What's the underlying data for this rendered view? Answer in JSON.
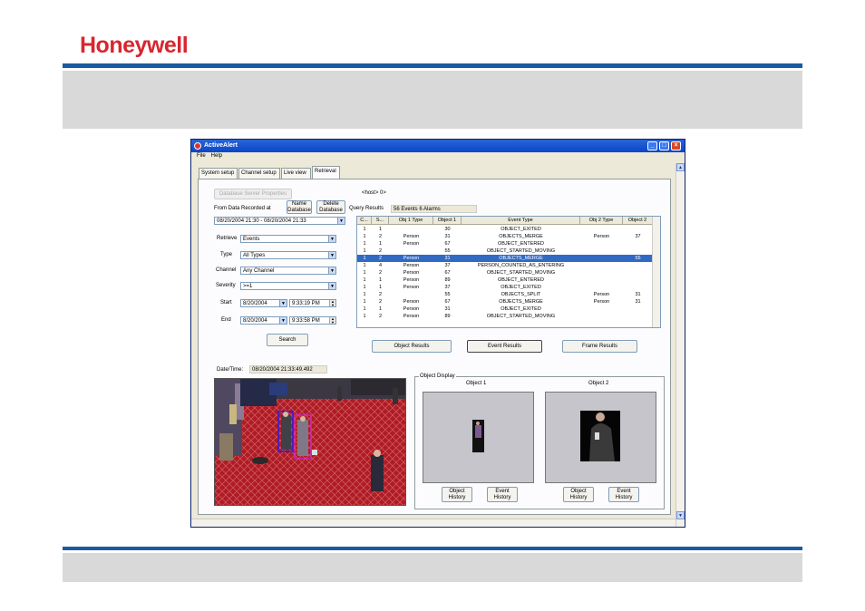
{
  "brand": {
    "logo": "Honeywell",
    "accent": "#d8262f",
    "line_color": "#1a5aa0"
  },
  "window": {
    "title": "ActiveAlert",
    "menu": [
      "File",
      "Help"
    ],
    "tabs": [
      "System setup",
      "Channel setup",
      "Live view",
      "Retrieval"
    ],
    "active_tab": "Retrieval"
  },
  "left": {
    "db_server_button": "Database Server Properties",
    "host_label": "<host> 0>",
    "name_db_button": "Name Database",
    "delete_db_button": "Delete Database",
    "from_data_label": "From Data Recorded at",
    "date_range": "08/20/2004 21:30 - 08/20/2004 21:33",
    "retrieve_label": "Retrieve",
    "retrieve_value": "Events",
    "type_label": "Type",
    "type_value": "All Types",
    "channel_label": "Channel",
    "channel_value": "Any Channel",
    "severity_label": "Severity",
    "severity_value": ">=1",
    "start_label": "Start",
    "start_date": "8/20/2004",
    "start_time": "9:33:19 PM",
    "end_label": "End",
    "end_date": "8/20/2004",
    "end_time": "9:33:58 PM",
    "search_button": "Search"
  },
  "query": {
    "label": "Query Results",
    "value": "56 Events 6 Alarms"
  },
  "table": {
    "headers": [
      "C...",
      "S...",
      "Obj 1 Type",
      "Object 1",
      "Event Type",
      "Obj 2 Type",
      "Object 2"
    ],
    "rows": [
      [
        "1",
        "1",
        "",
        "30",
        "OBJECT_EXITED",
        "",
        ""
      ],
      [
        "1",
        "2",
        "Person",
        "31",
        "OBJECTS_MERGE",
        "Person",
        "37"
      ],
      [
        "1",
        "1",
        "Person",
        "67",
        "OBJECT_ENTERED",
        "",
        ""
      ],
      [
        "1",
        "2",
        "",
        "55",
        "OBJECT_STARTED_MOVING",
        "",
        ""
      ],
      [
        "1",
        "2",
        "Person",
        "31",
        "OBJECTS_MERGE",
        "",
        "55"
      ],
      [
        "1",
        "4",
        "Person",
        "37",
        "PERSON_COUNTED_AS_ENTERING",
        "",
        ""
      ],
      [
        "1",
        "2",
        "Person",
        "67",
        "OBJECT_STARTED_MOVING",
        "",
        ""
      ],
      [
        "1",
        "1",
        "Person",
        "89",
        "OBJECT_ENTERED",
        "",
        ""
      ],
      [
        "1",
        "1",
        "Person",
        "37",
        "OBJECT_EXITED",
        "",
        ""
      ],
      [
        "1",
        "2",
        "",
        "55",
        "OBJECTS_SPLIT",
        "Person",
        "31"
      ],
      [
        "1",
        "2",
        "Person",
        "67",
        "OBJECTS_MERGE",
        "Person",
        "31"
      ],
      [
        "1",
        "1",
        "Person",
        "31",
        "OBJECT_EXITED",
        "",
        ""
      ],
      [
        "1",
        "2",
        "Person",
        "89",
        "OBJECT_STARTED_MOVING",
        "",
        ""
      ]
    ],
    "selected_row": 4
  },
  "results_buttons": {
    "object": "Object Results",
    "event": "Event Results",
    "frame": "Frame Results"
  },
  "datetime": {
    "label": "Date/Time:",
    "value": "08/20/2004 21:33:49.492"
  },
  "object_display": {
    "title": "Object Display",
    "object1_label": "Object 1",
    "object2_label": "Object 2",
    "object_history": "Object History",
    "event_history": "Event History"
  },
  "colors": {
    "selected_row": "#316ac5",
    "titlebar": "#0a46c8"
  }
}
